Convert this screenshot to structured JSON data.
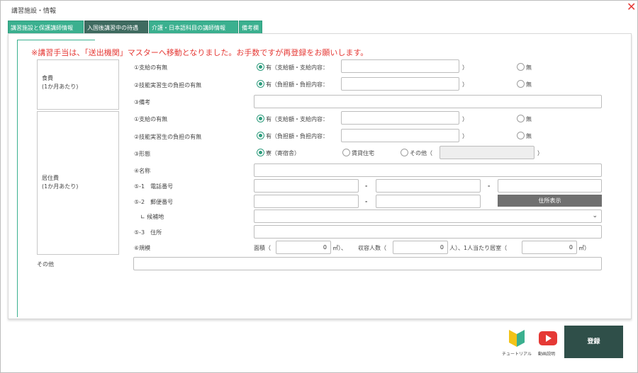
{
  "window": {
    "title": "講習施設・情報"
  },
  "tabs": [
    {
      "label": "講習施設と保護講師情報"
    },
    {
      "label": "入国後講習中の待遇"
    },
    {
      "label": "介護・日本語科目の講師情報"
    },
    {
      "label": "備考欄"
    }
  ],
  "notice": "※講習手当は、「送出機関」マスターへ移動となりました。お手数ですが再登録をお願いします。",
  "food": {
    "group_label": "食費\n(1か月あたり)",
    "row1": {
      "label": "①支給の有無",
      "yes": "有（支給額・支給内容：",
      "close": "）",
      "no": "無"
    },
    "row2": {
      "label": "②技能実習生の負担の有無",
      "yes": "有（負担額・負担内容：",
      "close": "）",
      "no": "無"
    },
    "row3": {
      "label": "③備考"
    }
  },
  "housing": {
    "group_label": "居住費\n(1か月あたり)",
    "row1": {
      "label": "①支給の有無",
      "yes": "有（支給額・支給内容：",
      "close": "）",
      "no": "無"
    },
    "row2": {
      "label": "②技能実習生の負担の有無",
      "yes": "有（負担額・負担内容：",
      "close": "）",
      "no": "無"
    },
    "row3": {
      "label": "③形態",
      "opt1": "寮（寄宿舎）",
      "opt2": "賃貸住宅",
      "opt3": "その他（",
      "close": "）"
    },
    "row4": {
      "label": "④名称"
    },
    "row5": {
      "label": "⑤-1　電話番号",
      "dash": "-"
    },
    "row6": {
      "label": "⑤-2　郵便番号",
      "dash": "-",
      "address_button": "住所表示"
    },
    "row7": {
      "label": "∟ 候補地"
    },
    "row8": {
      "label": "⑤-3　住所"
    },
    "row9": {
      "label": "⑥規模",
      "area_label": "面積（",
      "area_value": "0",
      "area_unit": "㎡）、",
      "capacity_label": "収容人数（",
      "capacity_value": "0",
      "capacity_unit": "人）、1人当たり居室（",
      "per_value": "0",
      "per_unit": "㎡）"
    }
  },
  "other": {
    "label": "その他"
  },
  "footer": {
    "tutorial_label": "チュートリアル",
    "video_label": "動画説明",
    "register_label": "登録"
  },
  "colors": {
    "accent": "#3bb08f",
    "active_tab": "#3f6b60",
    "notice": "#e53935",
    "register": "#2f4f49"
  }
}
